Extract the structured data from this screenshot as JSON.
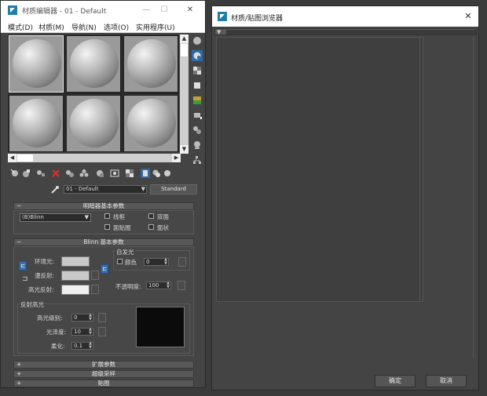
{
  "material_editor": {
    "title": "材质编辑器 - 01 - Default",
    "window_controls": {
      "minimize": "—",
      "maximize": "☐",
      "close": "✕"
    },
    "menu": [
      "模式(D)",
      "材质(M)",
      "导航(N)",
      "选项(O)",
      "实用程序(U)"
    ],
    "current_material": "01 - Default",
    "material_type": "Standard",
    "rollouts": {
      "shader_basic": {
        "title": "明暗器基本参数",
        "shader": "(B)Blinn",
        "options": [
          "线框",
          "双面",
          "面贴图",
          "面状"
        ]
      },
      "blinn_basic": {
        "title": "Blinn 基本参数",
        "ambient": "环境光:",
        "diffuse": "漫反射:",
        "specular": "高光反射:",
        "self_illum_group": "自发光",
        "color_label": "颜色",
        "self_illum_value": "0",
        "opacity_label": "不透明度:",
        "opacity_value": "100",
        "specular_highlights": "反射高光",
        "specular_level_label": "高光级别:",
        "specular_level_value": "0",
        "glossiness_label": "光泽度:",
        "glossiness_value": "10",
        "soften_label": "柔化:",
        "soften_value": "0.1"
      },
      "extended": {
        "title": "扩展参数"
      },
      "supersampling": {
        "title": "超级采样"
      },
      "maps": {
        "title": "贴图"
      }
    }
  },
  "browser": {
    "title": "材质/贴图浏览器",
    "close": "✕",
    "ok_label": "确定",
    "cancel_label": "取消"
  },
  "colors": {
    "background": "#3b3b3b",
    "panel": "#444444",
    "highlight": "#2e6aa8"
  }
}
